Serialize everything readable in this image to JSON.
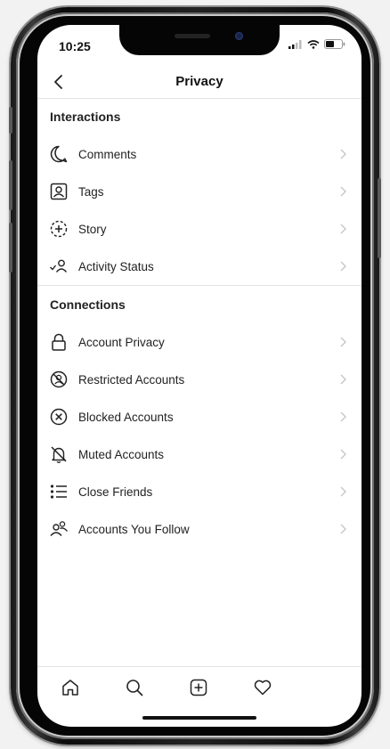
{
  "status_bar": {
    "time": "10:25"
  },
  "header": {
    "title": "Privacy"
  },
  "sections": [
    {
      "title": "Interactions",
      "items": [
        {
          "label": "Comments",
          "icon": "comment-icon"
        },
        {
          "label": "Tags",
          "icon": "tag-icon"
        },
        {
          "label": "Story",
          "icon": "story-icon"
        },
        {
          "label": "Activity Status",
          "icon": "activity-status-icon"
        }
      ]
    },
    {
      "title": "Connections",
      "items": [
        {
          "label": "Account Privacy",
          "icon": "lock-icon"
        },
        {
          "label": "Restricted Accounts",
          "icon": "restricted-icon"
        },
        {
          "label": "Blocked Accounts",
          "icon": "blocked-icon"
        },
        {
          "label": "Muted Accounts",
          "icon": "muted-bell-icon"
        },
        {
          "label": "Close Friends",
          "icon": "close-friends-list-icon"
        },
        {
          "label": "Accounts You Follow",
          "icon": "following-icon"
        }
      ]
    }
  ],
  "tab_bar": {
    "tabs": [
      "home-icon",
      "search-icon",
      "add-post-icon",
      "heart-icon"
    ]
  },
  "colors": {
    "text": "#222222",
    "chevron": "#c4c4c4",
    "divider": "#e3e3e3",
    "camera": "#1a2346"
  }
}
